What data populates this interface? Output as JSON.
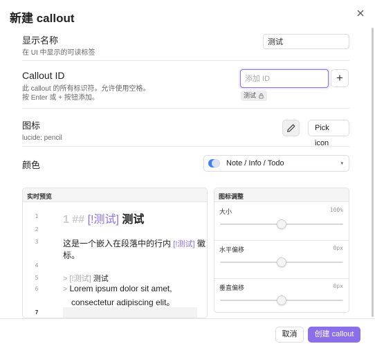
{
  "dialog": {
    "title": "新建 callout"
  },
  "display_name": {
    "name": "显示名称",
    "desc": "在 UI 中显示的可读标签",
    "value": "测试"
  },
  "callout_id": {
    "name": "Callout ID",
    "desc_line1": "此 callout 的所有标识符。允许使用空格。",
    "desc_line2": "按 Enter 或 + 按钮添加。",
    "placeholder": "添加 ID",
    "add_label": "+",
    "tag_label": "测试"
  },
  "icon": {
    "name": "图标",
    "desc": "lucide: pencil",
    "pick_label": "Pick icon"
  },
  "color": {
    "name": "颜色",
    "selected": "Note / Info / Todo",
    "swatch": "#3b82f6"
  },
  "preview": {
    "header": "实时预览",
    "line_numbers": [
      "1",
      "2",
      "3",
      "4",
      "5",
      "6",
      "7"
    ],
    "line1_prefix": "1 ## ",
    "line1_callout": "[!测试]",
    "line1_text": "测试",
    "line3_text_a": "这是一个嵌入在段落中的行内 ",
    "line3_callout": "[!测试]",
    "line3_text_b": " 徽",
    "line3_cont": "标。",
    "line5_marker": "> ",
    "line5_callout": "[!测试]",
    "line5_text": " 测试",
    "line6_marker": "> ",
    "line6_text": "Lorem ipsum dolor sit amet,",
    "line6_cont": "consectetur adipiscing elit。"
  },
  "icon_adjust": {
    "header": "图标调整",
    "rows": [
      {
        "label": "大小",
        "value": "100%",
        "position": 0.5
      },
      {
        "label": "水平偏移",
        "value": "0px",
        "position": 0.5
      },
      {
        "label": "垂直偏移",
        "value": "0px",
        "position": 0.5
      }
    ]
  },
  "footer": {
    "cancel_label": "取消",
    "create_label": "创建 callout"
  },
  "colors": {
    "accent": "#8b6ee9",
    "callout_text": "#8b6ee9"
  }
}
